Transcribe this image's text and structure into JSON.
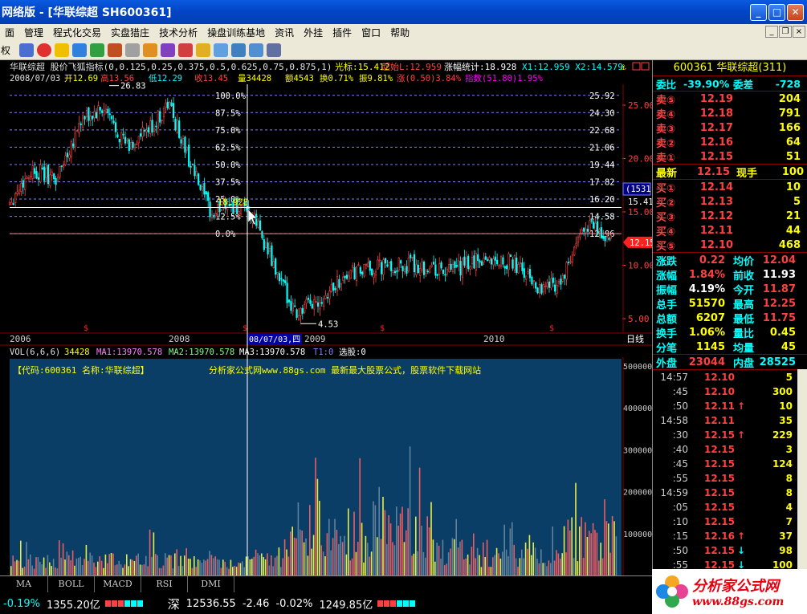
{
  "window": {
    "title": "网络版 - [华联综超  SH600361]",
    "min": "_",
    "max": "□",
    "close": "✕"
  },
  "menu": [
    "面",
    "管理",
    "程式化交易",
    "实盘猎庄",
    "技术分析",
    "操盘训练基地",
    "资讯",
    "外挂",
    "插件",
    "窗口",
    "帮助"
  ],
  "mdi": {
    "min": "_",
    "restore": "❐",
    "close": "×"
  },
  "toolbar": {
    "label": "权"
  },
  "chart": {
    "header1": "华联综超 股价飞狐指标(0,0.125,0.25,0.375,0.5,0.625,0.75,0.875,1)",
    "h1_cursor": "光标:15.412",
    "h1_start": "起始L:12.959",
    "h1_stats": "涨幅统计:18.928",
    "h1_x": "X1:12.959 X2:14.579",
    "header2_date": "2008/07/03",
    "h2_open": "开12.69",
    "h2_high": "高13.56",
    "h2_low": "低12.29",
    "h2_close": "收13.45",
    "h2_vol": "量34428",
    "h2_amt": "额4543",
    "h2_turn": "换0.71%",
    "h2_amp": "振9.81%",
    "h2_chg": "涨(0.50)3.84%",
    "h2_idx": "指数(51.80)1.95%",
    "fib_pct": [
      "100.0%",
      "87.5%",
      "75.0%",
      "62.5%",
      "50.0%",
      "37.5%",
      "25.0%",
      "12.5%",
      "0.0%"
    ],
    "fib_val": [
      "25.92",
      "24.30",
      "22.68",
      "21.06",
      "19.44",
      "17.82",
      "16.20",
      "14.58",
      "12.96"
    ],
    "y_ticks": [
      "25.00",
      "20.00",
      "15.00",
      "10.00",
      "5.00"
    ],
    "price_high_label": "26.83",
    "price_low_label": "4.53",
    "cursor_label": "18.928",
    "cursor_box": "(1531)",
    "cursor_price": "15.41",
    "last_price": "12.15",
    "x_years": [
      "2006",
      "2008",
      "2009",
      "2010"
    ],
    "x_cursor": "08/07/03,四",
    "period": "日线",
    "dividend_mark": "$"
  },
  "vol": {
    "header": "VOL(6,6,6)",
    "vol_val": "34428",
    "ma1": "MA1:13970.578",
    "ma2": "MA2:13970.578",
    "ma3": "MA3:13970.578",
    "t1": "T1:0",
    "pick": "选股:0",
    "code_info": "【代码:600361 名称:华联综超】",
    "ad": "分析家公式网www.88gs.com 最新最大股票公式，股票软件下载网站",
    "y_ticks": [
      "500000",
      "400000",
      "300000",
      "200000",
      "100000"
    ]
  },
  "tabs": [
    "MA",
    "BOLL",
    "MACD",
    "RSI",
    "DMI"
  ],
  "panel": {
    "head": "600361 华联综超(311)",
    "weibi_l": "委比",
    "weibi": "-39.90%",
    "weicha_l": "委差",
    "weicha": "-728",
    "sells": [
      {
        "l": "卖⑤",
        "p": "12.19",
        "v": "204"
      },
      {
        "l": "卖④",
        "p": "12.18",
        "v": "791"
      },
      {
        "l": "卖③",
        "p": "12.17",
        "v": "166"
      },
      {
        "l": "卖②",
        "p": "12.16",
        "v": "64"
      },
      {
        "l": "卖①",
        "p": "12.15",
        "v": "51"
      }
    ],
    "latest_l": "最新",
    "latest": "12.15",
    "xianshou_l": "现手",
    "xianshou": "100",
    "buys": [
      {
        "l": "买①",
        "p": "12.14",
        "v": "10"
      },
      {
        "l": "买②",
        "p": "12.13",
        "v": "5"
      },
      {
        "l": "买③",
        "p": "12.12",
        "v": "21"
      },
      {
        "l": "买④",
        "p": "12.11",
        "v": "44"
      },
      {
        "l": "买⑤",
        "p": "12.10",
        "v": "468"
      }
    ],
    "quotes": [
      {
        "l1": "涨跌",
        "v1": "0.22",
        "l2": "均价",
        "v2": "12.04"
      },
      {
        "l1": "涨幅",
        "v1": "1.84%",
        "l2": "前收",
        "v2": "11.93"
      },
      {
        "l1": "振幅",
        "v1": "4.19%",
        "l2": "今开",
        "v2": "11.87"
      },
      {
        "l1": "总手",
        "v1": "51570",
        "l2": "最高",
        "v2": "12.25"
      },
      {
        "l1": "总额",
        "v1": "6207",
        "l2": "最低",
        "v2": "11.75"
      },
      {
        "l1": "换手",
        "v1": "1.06%",
        "l2": "量比",
        "v2": "0.45"
      },
      {
        "l1": "分笔",
        "v1": "1145",
        "l2": "均量",
        "v2": "45"
      }
    ],
    "outer_l": "外盘",
    "outer": "23044",
    "inner_l": "内盘",
    "inner": "28525",
    "ticks": [
      {
        "t": "14:57",
        "p": "12.10",
        "a": "",
        "v": "5"
      },
      {
        "t": ":45",
        "p": "12.10",
        "a": "",
        "v": "300"
      },
      {
        "t": ":50",
        "p": "12.11",
        "a": "↑",
        "v": "10"
      },
      {
        "t": "14:58",
        "p": "12.11",
        "a": "",
        "v": "35"
      },
      {
        "t": ":30",
        "p": "12.15",
        "a": "↑",
        "v": "229"
      },
      {
        "t": ":40",
        "p": "12.15",
        "a": "",
        "v": "3"
      },
      {
        "t": ":45",
        "p": "12.15",
        "a": "",
        "v": "124"
      },
      {
        "t": ":55",
        "p": "12.15",
        "a": "",
        "v": "8"
      },
      {
        "t": "14:59",
        "p": "12.15",
        "a": "",
        "v": "8"
      },
      {
        "t": ":05",
        "p": "12.15",
        "a": "",
        "v": "4"
      },
      {
        "t": ":10",
        "p": "12.15",
        "a": "",
        "v": "7"
      },
      {
        "t": ":15",
        "p": "12.16",
        "a": "↑",
        "v": "37"
      },
      {
        "t": ":50",
        "p": "12.15",
        "a": "↓",
        "v": "98"
      },
      {
        "t": ":55",
        "p": "12.15",
        "a": "↓",
        "v": "100"
      }
    ]
  },
  "status": {
    "left_chg": "-0.19%",
    "left_amt": "1355.20亿",
    "mkt": "深",
    "mkt_idx": "12536.55",
    "mkt_chg": "-2.46",
    "mkt_pct": "-0.02%",
    "mkt_amt": "1249.85亿"
  },
  "logo": {
    "l1": "分析家公式网",
    "l2": "www.88gs.com"
  },
  "colors": {
    "up": "#ff4040",
    "down": "#00ffff",
    "vol_bg": "#0b3e67",
    "fib": "#8080ff"
  }
}
